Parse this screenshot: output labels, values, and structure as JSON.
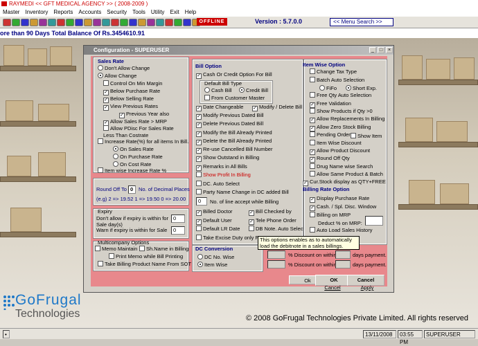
{
  "app": {
    "title": "RAYMEDI << GFT MEDICAL AGENCY >> ( 2008-2009 )",
    "offline": "OFFLINE",
    "version": "Version : 5.7.0.0",
    "menu_search": "<< Menu Search >>",
    "marquee": "ore than 90 Days Total Balance Of Rs.3454610.91"
  },
  "menu": [
    "Master",
    "Inventory",
    "Reports",
    "Accounts",
    "Security",
    "Tools",
    "Utility",
    "Exit",
    "Help"
  ],
  "logo": {
    "brand": "GoFrugal",
    "sub": "Technologies"
  },
  "copyright": "© 2008 GoFrugal Technologies Private Limited. All rights reserved",
  "status": {
    "date": "13/11/2008",
    "time": "03:55 PM",
    "user": "SUPERUSER"
  },
  "dialog": {
    "title": "Configuration - SUPERUSER",
    "sales_rate": {
      "title": "Sales Rate",
      "dont_allow": "Don't Allow Change",
      "allow": "Allow Change",
      "control_min_margin": "Control On Min Margin",
      "below_purchase": "Below Purchase Rate",
      "below_selling": "Below Selling Rate",
      "view_previous": "View Previous Rates",
      "previous_year": "Previous Year also",
      "allow_mrp": "Allow Sales Rate > MRP",
      "allow_pdisc": "Allow PDisc For Sales Rate Less Than Costrate",
      "increase_rate": "Increase Rate(%) for all items In Bill.",
      "on_sales": "On Sales Rate",
      "on_purchase": "On Purchase Rate",
      "on_cost": "On Cost Rate",
      "item_wise": "Item wise Increase Rate %"
    },
    "round_off": {
      "label_pre": "Round Off To",
      "value": "0",
      "label_post": "No. of Decimal Places",
      "example": "(e.g) 2  => 19.52   1 => 19.50   0 => 20.00"
    },
    "expiry": {
      "title": "Expiry",
      "dont_allow": "Don't allow if expiry is within for Sale day(s)",
      "dont_allow_val": "0",
      "warn": "Warn  if expiry is within for Sale",
      "warn_val": "0"
    },
    "multicompany": {
      "title": "Multicompany Options",
      "memo_maintain": "Memo Maintain",
      "sh_name": "Sh.Name in Billing",
      "print_memo": "Print Memo while Bill Printing",
      "take_billing": "Take Billing Product Name From SOT"
    },
    "bill_option": {
      "title": "Bill Option",
      "cash_credit": "Cash Or Credit Option For Bill",
      "default_type": "Default Bill Type",
      "cash_bill": "Cash Bill",
      "credit_bill": "Credit Bill",
      "from_customer": "From Customer Master",
      "date_changeable": "Date Changeable",
      "modify_delete": "Modify / Delete Bill",
      "modify_previous": "Modify Previous Dated Bill",
      "delete_previous": "Delete Previous Dated Bill",
      "modify_printed": "Modify the Bill Already Printed",
      "delete_printed": "Delete the Bill Already Printed",
      "reuse_cancelled": "Re-use Cancelled Bill Number",
      "show_outstand": "Show Outstand in Billing",
      "remarks": "Remarks in All Bills",
      "show_profit": "Show Profit In Billing",
      "dc_auto": "DC. Auto Select",
      "party_name": "Party Name Change in DC added Bill",
      "line_accept": "No. of line accept while Billing",
      "line_val": "0",
      "billed_doctor": "Billed Doctor",
      "bill_checked": "Bill Checked by",
      "default_user": "Default User",
      "tele_phone": "Tele Phone Order",
      "default_lr": "Default LR Date",
      "db_note": "DB Note. Auto Select",
      "take_excise": "Take Excise Duty only F"
    },
    "dc_conversion": {
      "title": "DC Conversion",
      "dc_no": "DC No. Wise",
      "item_wise": "Item Wise"
    },
    "discount": {
      "pct_within": "% Discount on within",
      "days_payment": "days payment."
    },
    "item_wise": {
      "title": "Item Wise Option",
      "change_tax": "Change Tax Type",
      "batch_auto": "Batch Auto Selection",
      "fifo": "FiFo",
      "short_exp": "Short Exp.",
      "free_qty": "Free Qty Auto Selection",
      "free_validation": "Free Validation",
      "show_products": "Show Products if Qty >0",
      "allow_replacements": "Allow Replacements In Billing",
      "allow_zero": "Allow Zero Stock Billing",
      "pending_order": "Pending Order",
      "show_item": "Show Item",
      "item_wise_discount": "Item Wise Discount",
      "allow_product_discount": "Allow Product Discount",
      "round_off_qty": "Round Off Qty",
      "drug_name": "Drug Name wise Search",
      "allow_same": "Allow Same Product & Batch",
      "cur_stock": "Cur.Stock display as QTY+FREE"
    },
    "billing_rate": {
      "title": "Billing Rate Option",
      "display_purchase": "Display Purchase Rate",
      "cash_spl": "Cash. / Spl. Disc. Window",
      "billing_mrp": "Billing on MRP",
      "deduct_mrp": "Deduct % on MRP:",
      "auto_load": "Auto Load Sales History"
    },
    "buttons": {
      "ok": "OK",
      "cancel": "Cancel",
      "ok_bg": "Ok",
      "cancel_bg": "Cancel",
      "apply_bg": "Apply"
    },
    "tooltip": "This options enables as to automatically load the debitnote in a sales billings."
  }
}
